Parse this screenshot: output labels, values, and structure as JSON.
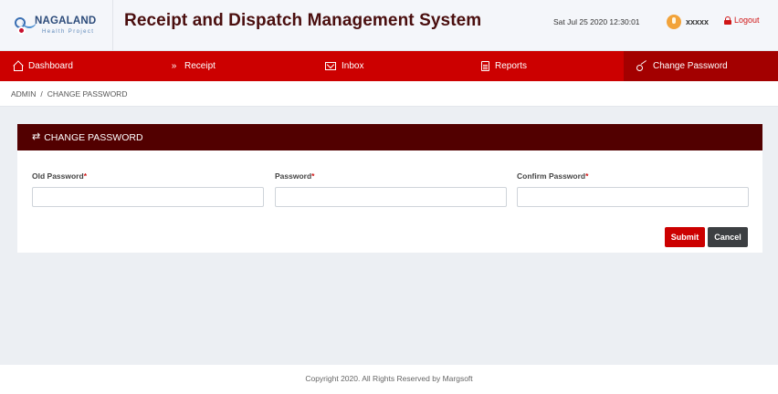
{
  "header": {
    "logo_name": "NAGALAND",
    "logo_subtitle": "Health Project",
    "app_title": "Receipt and Dispatch Management System",
    "datetime": "Sat Jul 25 2020 12:30:01",
    "username": "xxxxx",
    "logout_label": "Logout"
  },
  "nav": {
    "items": [
      {
        "label": "Dashboard",
        "icon": "home-icon"
      },
      {
        "label": "Receipt",
        "icon": "double-chevron-down-icon"
      },
      {
        "label": "Inbox",
        "icon": "inbox-icon"
      },
      {
        "label": "Reports",
        "icon": "report-icon"
      },
      {
        "label": "Change Password",
        "icon": "key-icon",
        "active": true
      }
    ]
  },
  "breadcrumb": {
    "root": "ADMIN",
    "separator": "/",
    "current": "CHANGE PASSWORD"
  },
  "form": {
    "title": "CHANGE PASSWORD",
    "required_mark": "*",
    "fields": [
      {
        "label": "Old Password",
        "value": "",
        "placeholder": ""
      },
      {
        "label": "Password",
        "value": "",
        "placeholder": ""
      },
      {
        "label": "Confirm Password",
        "value": "",
        "placeholder": ""
      }
    ],
    "submit_label": "Submit",
    "cancel_label": "Cancel"
  },
  "footer": {
    "copyright": "Copyright 2020. All Rights Reserved by Margsoft"
  },
  "colors": {
    "nav_bg": "#cc0000",
    "nav_active_bg": "#a30000",
    "card_header_bg": "#520000",
    "title_color": "#4a0e0e",
    "submit_bg": "#cc0000",
    "cancel_bg": "#3c3f42"
  }
}
